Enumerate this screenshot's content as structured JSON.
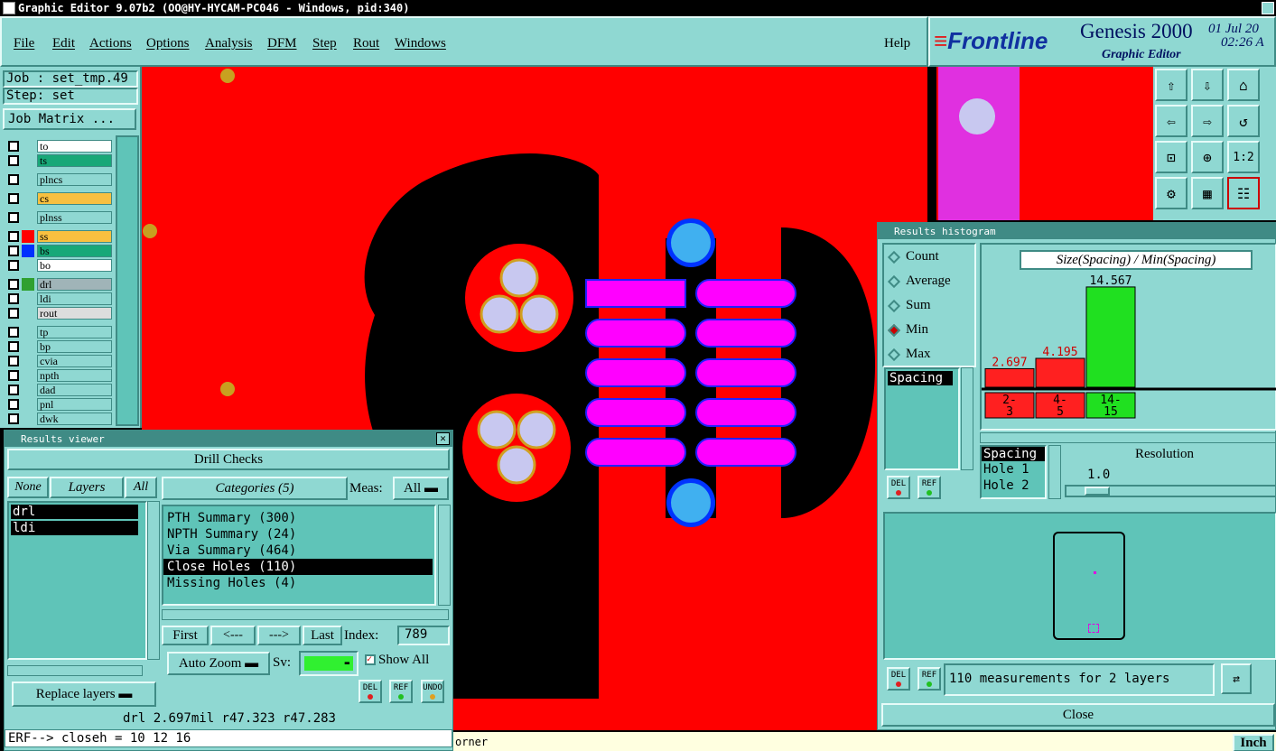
{
  "window_title": "Graphic Editor 9.07b2 (OO@HY-HYCAM-PC046 - Windows, pid:340)",
  "menu": [
    "File",
    "Edit",
    "Actions",
    "Options",
    "Analysis",
    "DFM",
    "Step",
    "Rout",
    "Windows"
  ],
  "help": "Help",
  "brand": {
    "logo": "Frontline",
    "product": "Genesis 2000",
    "subtitle": "Graphic Editor",
    "date": "01 Jul 20",
    "time": "02:26 A"
  },
  "job": {
    "job_label": "Job : set_tmp.49",
    "step_label": "Step: set",
    "matrix_button": "Job Matrix ..."
  },
  "layers": [
    {
      "name": "to",
      "color": "#ffffff",
      "swatch": ""
    },
    {
      "name": "ts",
      "color": "#18a878",
      "swatch": ""
    },
    {
      "name": "plncs",
      "color": "#8fd8d2",
      "swatch": ""
    },
    {
      "name": "cs",
      "color": "#f8c040",
      "swatch": ""
    },
    {
      "name": "plnss",
      "color": "#8fd8d2",
      "swatch": ""
    },
    {
      "name": "ss",
      "color": "#f8c040",
      "swatch": "#ff0000"
    },
    {
      "name": "bs",
      "color": "#18a878",
      "swatch": "#0030ff"
    },
    {
      "name": "bo",
      "color": "#ffffff",
      "swatch": ""
    },
    {
      "name": "drl",
      "color": "#a0b4b8",
      "swatch": "#30a030"
    },
    {
      "name": "ldi",
      "color": "#8fd8d2",
      "swatch": ""
    },
    {
      "name": "rout",
      "color": "#dddddd",
      "swatch": ""
    },
    {
      "name": "tp",
      "color": "#8fd8d2",
      "swatch": ""
    },
    {
      "name": "bp",
      "color": "#8fd8d2",
      "swatch": ""
    },
    {
      "name": "cvia",
      "color": "#8fd8d2",
      "swatch": ""
    },
    {
      "name": "npth",
      "color": "#8fd8d2",
      "swatch": ""
    },
    {
      "name": "dad",
      "color": "#8fd8d2",
      "swatch": ""
    },
    {
      "name": "pnl",
      "color": "#8fd8d2",
      "swatch": ""
    },
    {
      "name": "dwk",
      "color": "#8fd8d2",
      "swatch": ""
    }
  ],
  "results_viewer": {
    "title": "Results viewer",
    "header": "Drill Checks",
    "none_btn": "None",
    "layers_btn": "Layers",
    "all_btn": "All",
    "layer_list": [
      "drl",
      "ldi"
    ],
    "categories_btn": "Categories (5)",
    "meas_label": "Meas:",
    "meas_value": "All",
    "categories": [
      "PTH Summary (300)",
      "NPTH Summary (24)",
      "Via Summary (464)",
      "Close Holes (110)",
      "Missing Holes (4)"
    ],
    "selected_category": "Close Holes (110)",
    "first": "First",
    "prev": "<---",
    "next": "--->",
    "last": "Last",
    "index_label": "Index:",
    "index_value": "789",
    "auto_zoom": "Auto Zoom",
    "sv_label": "Sv:",
    "show_all": "Show All",
    "replace_layers": "Replace layers",
    "del": "DEL",
    "ref": "REF",
    "undo": "UNDO",
    "status": "drl 2.697mil  r47.323  r47.283",
    "erf": "ERF--> closeh = 10 12 16"
  },
  "histogram": {
    "title": "Results histogram",
    "modes": [
      "Count",
      "Average",
      "Sum",
      "Min",
      "Max"
    ],
    "selected_mode": "Min",
    "chart_title": "Size(Spacing) / Min(Spacing)",
    "spacing_list": [
      "Spacing"
    ],
    "resolution_label": "Resolution",
    "resolution_value": "1.0",
    "attr_list": [
      "Spacing",
      "Hole 1",
      "Hole 2"
    ],
    "measurement_text": "110 measurements for 2 layers",
    "close": "Close",
    "del": "DEL",
    "ref": "REF"
  },
  "chart_data": {
    "type": "bar",
    "title": "Size(Spacing) / Min(Spacing)",
    "categories": [
      "2-3",
      "4-5",
      "14-15"
    ],
    "values": [
      2.697,
      4.195,
      14.567
    ],
    "colors": [
      "#ff2020",
      "#ff2020",
      "#20e020"
    ],
    "ylim": [
      0,
      16
    ]
  },
  "bottom": {
    "corner_text": "orner",
    "units": "Inch"
  },
  "colors": {
    "board": "#ff0000",
    "copper": "#000000",
    "pad": "#ff00ff",
    "hole": "#c8c8f0",
    "via": "#40b0f0",
    "panel": "#8fd8d2"
  }
}
